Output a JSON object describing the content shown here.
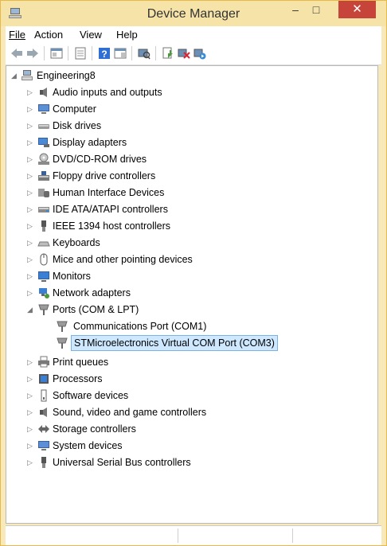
{
  "window": {
    "title": "Device Manager",
    "minimize": "–",
    "maximize": "□",
    "close": "✕"
  },
  "menu": {
    "file": "File",
    "action": "Action",
    "view": "View",
    "help": "Help"
  },
  "tree": {
    "root": "Engineering8",
    "items": [
      {
        "label": "Audio inputs and outputs",
        "icon": "audio-icon"
      },
      {
        "label": "Computer",
        "icon": "computer-icon"
      },
      {
        "label": "Disk drives",
        "icon": "disk-drive-icon"
      },
      {
        "label": "Display adapters",
        "icon": "display-adapter-icon"
      },
      {
        "label": "DVD/CD-ROM drives",
        "icon": "dvd-icon"
      },
      {
        "label": "Floppy drive controllers",
        "icon": "floppy-icon"
      },
      {
        "label": "Human Interface Devices",
        "icon": "hid-icon"
      },
      {
        "label": "IDE ATA/ATAPI controllers",
        "icon": "ide-icon"
      },
      {
        "label": "IEEE 1394 host controllers",
        "icon": "ieee1394-icon"
      },
      {
        "label": "Keyboards",
        "icon": "keyboard-icon"
      },
      {
        "label": "Mice and other pointing devices",
        "icon": "mouse-icon"
      },
      {
        "label": "Monitors",
        "icon": "monitor-icon"
      },
      {
        "label": "Network adapters",
        "icon": "network-icon"
      },
      {
        "label": "Ports (COM & LPT)",
        "icon": "port-icon"
      },
      {
        "label": "Print queues",
        "icon": "printer-icon"
      },
      {
        "label": "Processors",
        "icon": "processor-icon"
      },
      {
        "label": "Software devices",
        "icon": "software-device-icon"
      },
      {
        "label": "Sound, video and game controllers",
        "icon": "sound-icon"
      },
      {
        "label": "Storage controllers",
        "icon": "storage-icon"
      },
      {
        "label": "System devices",
        "icon": "system-device-icon"
      },
      {
        "label": "Universal Serial Bus controllers",
        "icon": "usb-icon"
      }
    ],
    "ports_children": [
      {
        "label": "Communications Port (COM1)",
        "icon": "port-icon"
      },
      {
        "label": "STMicroelectronics Virtual COM Port (COM3)",
        "icon": "port-icon",
        "selected": true
      }
    ]
  },
  "colors": {
    "titlebar": "#f5e3a8",
    "close": "#c7443a",
    "selection": "#cde8ff"
  }
}
